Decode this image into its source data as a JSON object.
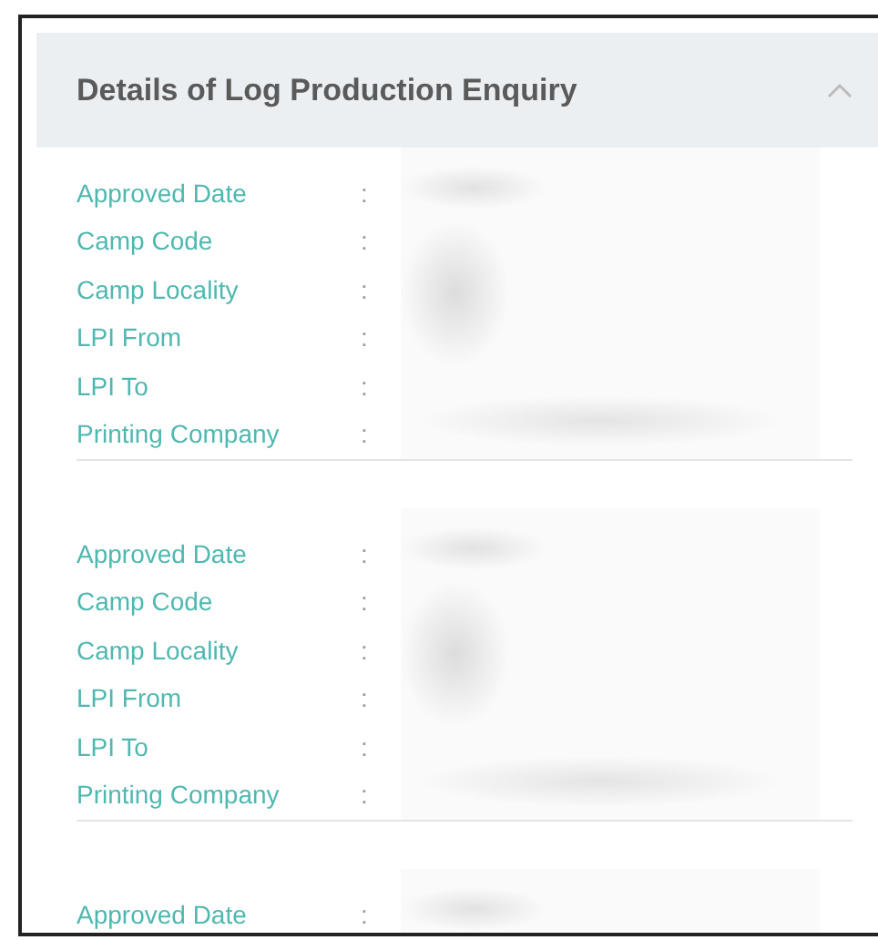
{
  "panel": {
    "title": "Details of Log Production Enquiry",
    "expanded": true
  },
  "records": [
    {
      "fields": [
        {
          "label": "Approved Date",
          "separator": ":"
        },
        {
          "label": "Camp Code",
          "separator": ":"
        },
        {
          "label": "Camp Locality",
          "separator": ":"
        },
        {
          "label": "LPI From",
          "separator": ":"
        },
        {
          "label": "LPI To",
          "separator": ":"
        },
        {
          "label": "Printing Company",
          "separator": ":"
        }
      ]
    },
    {
      "fields": [
        {
          "label": "Approved Date",
          "separator": ":"
        },
        {
          "label": "Camp Code",
          "separator": ":"
        },
        {
          "label": "Camp Locality",
          "separator": ":"
        },
        {
          "label": "LPI From",
          "separator": ":"
        },
        {
          "label": "LPI To",
          "separator": ":"
        },
        {
          "label": "Printing Company",
          "separator": ":"
        }
      ]
    },
    {
      "fields": [
        {
          "label": "Approved Date",
          "separator": ":"
        }
      ]
    }
  ]
}
